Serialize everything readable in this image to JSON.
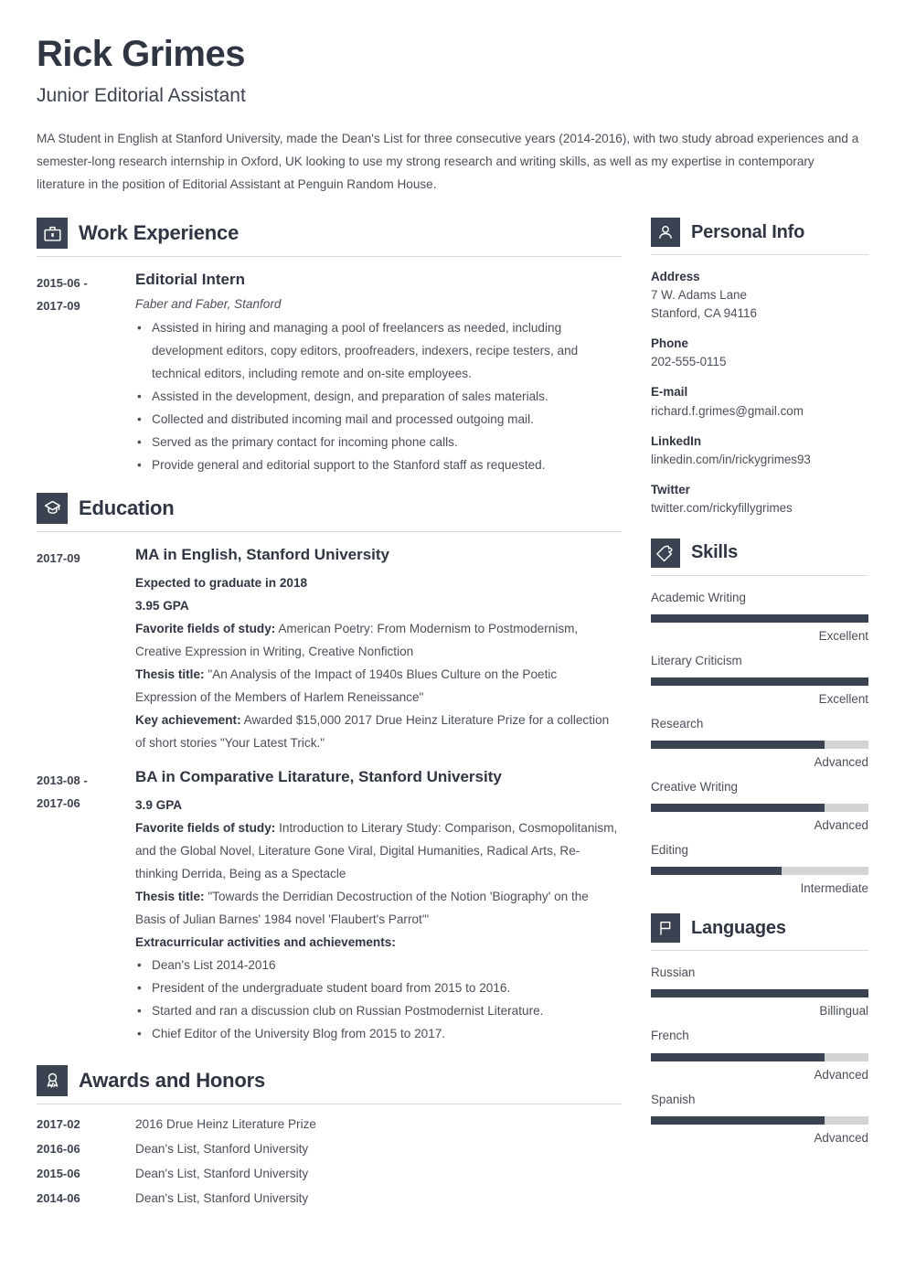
{
  "header": {
    "name": "Rick Grimes",
    "job_title": "Junior Editorial Assistant",
    "summary": "MA Student in English at Stanford University, made the Dean's List for three consecutive years (2014-2016), with two study abroad experiences and a semester-long research internship in Oxford, UK looking to use my strong research and writing skills, as well as my expertise in contemporary literature in the position of Editorial Assistant at Penguin Random House."
  },
  "colors": {
    "accent": "#3b4251",
    "heading": "#2f3542",
    "body": "#4a4f5a",
    "rule": "#d8dade",
    "track": "#d2d4d6"
  },
  "sections": {
    "work": {
      "title": "Work Experience",
      "icon": "briefcase-icon",
      "entries": [
        {
          "date": "2015-06 -\n2017-09",
          "date_line1": "2015-06 -",
          "date_line2": "2017-09",
          "title": "Editorial Intern",
          "subtitle": "Faber and Faber, Stanford",
          "bullets": [
            "Assisted in hiring and managing a pool of freelancers as needed, including development editors, copy editors, proofreaders, indexers, recipe testers, and technical editors, including remote and on-site employees.",
            "Assisted in the development, design, and preparation of sales materials.",
            "Collected and distributed incoming mail and processed outgoing mail.",
            "Served as the primary contact for incoming phone calls.",
            "Provide general and editorial support to the Stanford staff as requested."
          ]
        }
      ]
    },
    "education": {
      "title": "Education",
      "icon": "graduation-cap-icon",
      "entries": [
        {
          "date_line1": "2017-09",
          "date_line2": "",
          "title": "MA in English, Stanford University",
          "lines": [
            {
              "label": "Expected to graduate in 2018",
              "text": ""
            },
            {
              "label": "3.95 GPA",
              "text": ""
            },
            {
              "label": "Favorite fields of study:",
              "text": " American Poetry: From Modernism to Postmodernism, Creative Expression in Writing, Creative Nonfiction"
            },
            {
              "label": "Thesis title:",
              "text": " \"An Analysis of the Impact of 1940s Blues Culture on the Poetic Expression of the Members of Harlem Reneissance\""
            },
            {
              "label": "Key achievement:",
              "text": " Awarded $15,000 2017 Drue Heinz Literature Prize for a collection of short stories \"Your Latest Trick.\""
            }
          ],
          "bullets": []
        },
        {
          "date_line1": "2013-08 -",
          "date_line2": "2017-06",
          "title": "BA in Comparative Litarature, Stanford University",
          "lines": [
            {
              "label": "3.9 GPA",
              "text": ""
            },
            {
              "label": "Favorite fields of study:",
              "text": " Introduction to Literary Study: Comparison, Cosmopolitanism, and the Global Novel, Literature Gone Viral, Digital Humanities, Radical Arts, Re-thinking Derrida, Being as a Spectacle"
            },
            {
              "label": "Thesis title:",
              "text": " \"Towards the Derridian Decostruction of the Notion 'Biography' on the Basis of Julian Barnes' 1984 novel 'Flaubert's Parrot'\""
            },
            {
              "label": "Extracurricular activities and achievements:",
              "text": ""
            }
          ],
          "bullets": [
            "Dean's List 2014-2016",
            "President of the undergraduate student board from 2015 to 2016.",
            "Started and ran a discussion club on Russian Postmodernist Literature.",
            "Chief Editor of the University Blog from 2015 to 2017."
          ]
        }
      ]
    },
    "awards": {
      "title": "Awards and Honors",
      "icon": "award-ribbon-icon",
      "rows": [
        {
          "date": "2017-02",
          "text": "2016 Drue Heinz Literature Prize"
        },
        {
          "date": "2016-06",
          "text": "Dean's List, Stanford University"
        },
        {
          "date": "2015-06",
          "text": "Dean's List, Stanford University"
        },
        {
          "date": "2014-06",
          "text": "Dean's List, Stanford University"
        }
      ]
    },
    "personal_info": {
      "title": "Personal Info",
      "icon": "person-icon",
      "groups": [
        {
          "label": "Address",
          "value1": "7 W. Adams Lane",
          "value2": "Stanford, CA 94116"
        },
        {
          "label": "Phone",
          "value1": "202-555-0115",
          "value2": ""
        },
        {
          "label": "E-mail",
          "value1": "richard.f.grimes@gmail.com",
          "value2": ""
        },
        {
          "label": "LinkedIn",
          "value1": "linkedin.com/in/rickygrimes93",
          "value2": ""
        },
        {
          "label": "Twitter",
          "value1": "twitter.com/rickyfillygrimes",
          "value2": ""
        }
      ]
    },
    "skills": {
      "title": "Skills",
      "icon": "puzzle-piece-icon",
      "items": [
        {
          "name": "Academic Writing",
          "level": "Excellent",
          "percent": 100
        },
        {
          "name": "Literary Criticism",
          "level": "Excellent",
          "percent": 100
        },
        {
          "name": "Research",
          "level": "Advanced",
          "percent": 80
        },
        {
          "name": "Creative Writing",
          "level": "Advanced",
          "percent": 80
        },
        {
          "name": "Editing",
          "level": "Intermediate",
          "percent": 60
        }
      ]
    },
    "languages": {
      "title": "Languages",
      "icon": "flag-icon",
      "items": [
        {
          "name": "Russian",
          "level": "Billingual",
          "percent": 100
        },
        {
          "name": "French",
          "level": "Advanced",
          "percent": 80
        },
        {
          "name": "Spanish",
          "level": "Advanced",
          "percent": 80
        }
      ]
    }
  }
}
